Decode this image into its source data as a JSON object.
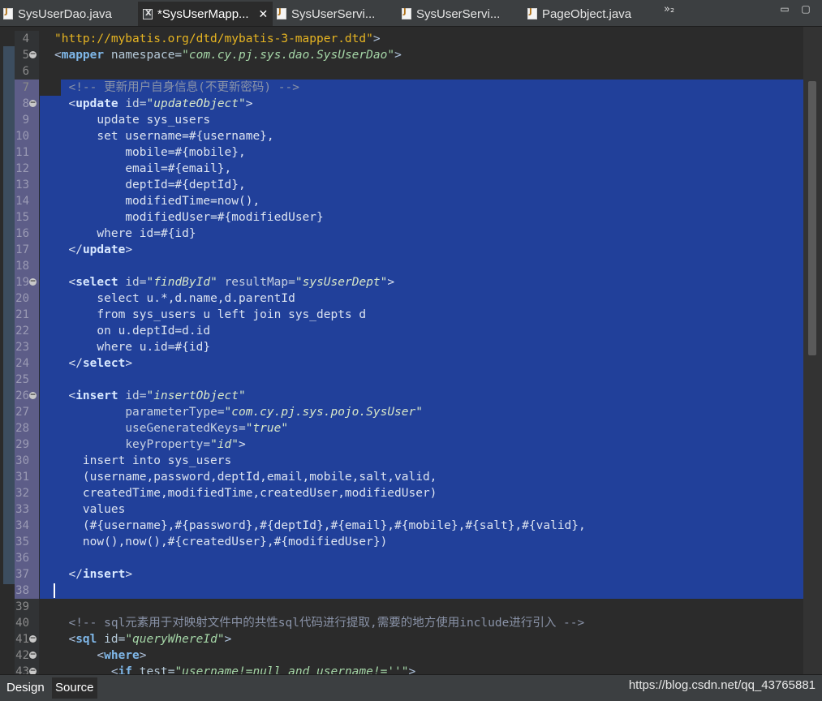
{
  "tabs": [
    {
      "label": "SysUserDao.java",
      "icon": "java-file-icon",
      "active": false
    },
    {
      "label": "*SysUserMapp...",
      "icon": "xml-file-icon",
      "active": true,
      "close": "✕"
    },
    {
      "label": "SysUserServi...",
      "icon": "java-file-icon",
      "active": false
    },
    {
      "label": "SysUserServi...",
      "icon": "java-file-icon",
      "active": false
    },
    {
      "label": "PageObject.java",
      "icon": "java-file-icon",
      "active": false
    }
  ],
  "tab_overflow": "»₂",
  "window_buttons": {
    "minimize": "▭",
    "maximize": "▢"
  },
  "editor": {
    "lines": [
      {
        "num": "4",
        "html": "<span class=\"dtd\">\"http://mybatis.org/dtd/mybatis-3-mapper.dtd\"</span><span class=\"punct\">&gt;</span>"
      },
      {
        "num": "5",
        "fold": "−",
        "html": "<span class=\"punct\">&lt;</span><span class=\"tag\">mapper</span> <span class=\"attr\">namespace=</span><span class=\"str\">\"com.cy.pj.sys.dao.SysUserDao\"</span><span class=\"punct\">&gt;</span>"
      },
      {
        "num": "6",
        "html": ""
      },
      {
        "num": "7",
        "partial": true,
        "html": "  <span class=\"cmt\">&lt;!-- 更新用户自身信息(不更新密码) --&gt;</span>"
      },
      {
        "num": "8",
        "sel": true,
        "fold": "−",
        "html": "  <span class=\"punct\">&lt;</span><span class=\"tag\">update</span> <span class=\"attr\">id=</span><span class=\"str\">\"updateObject\"</span><span class=\"punct\">&gt;</span>"
      },
      {
        "num": "9",
        "sel": true,
        "html": "      <span class=\"txtc\">update sys_users</span>"
      },
      {
        "num": "10",
        "sel": true,
        "html": "      <span class=\"txtc\">set username=#{username},</span>"
      },
      {
        "num": "11",
        "sel": true,
        "html": "          <span class=\"txtc\">mobile=#{mobile},</span>"
      },
      {
        "num": "12",
        "sel": true,
        "html": "          <span class=\"txtc\">email=#{email},</span>"
      },
      {
        "num": "13",
        "sel": true,
        "html": "          <span class=\"txtc\">deptId=#{deptId},</span>"
      },
      {
        "num": "14",
        "sel": true,
        "html": "          <span class=\"txtc\">modifiedTime=now(),</span>"
      },
      {
        "num": "15",
        "sel": true,
        "html": "          <span class=\"txtc\">modifiedUser=#{modifiedUser}</span>"
      },
      {
        "num": "16",
        "sel": true,
        "html": "      <span class=\"txtc\">where id=#{id}</span>"
      },
      {
        "num": "17",
        "sel": true,
        "html": "  <span class=\"punct\">&lt;/</span><span class=\"tag\">update</span><span class=\"punct\">&gt;</span>"
      },
      {
        "num": "18",
        "sel": true,
        "html": ""
      },
      {
        "num": "19",
        "sel": true,
        "fold": "−",
        "html": "  <span class=\"punct\">&lt;</span><span class=\"tag\">select</span> <span class=\"attr\">id=</span><span class=\"str\">\"findById\"</span> <span class=\"attr\">resultMap=</span><span class=\"str\">\"sysUserDept\"</span><span class=\"punct\">&gt;</span>"
      },
      {
        "num": "20",
        "sel": true,
        "html": "      <span class=\"txtc\">select u.*,d.name,d.parentId</span>"
      },
      {
        "num": "21",
        "sel": true,
        "html": "      <span class=\"txtc\">from sys_users u left join sys_depts d</span>"
      },
      {
        "num": "22",
        "sel": true,
        "html": "      <span class=\"txtc\">on u.deptId=d.id</span>"
      },
      {
        "num": "23",
        "sel": true,
        "html": "      <span class=\"txtc\">where u.id=#{id}</span>"
      },
      {
        "num": "24",
        "sel": true,
        "html": "  <span class=\"punct\">&lt;/</span><span class=\"tag\">select</span><span class=\"punct\">&gt;</span>"
      },
      {
        "num": "25",
        "sel": true,
        "html": ""
      },
      {
        "num": "26",
        "sel": true,
        "fold": "−",
        "html": "  <span class=\"punct\">&lt;</span><span class=\"tag\">insert</span> <span class=\"attr\">id=</span><span class=\"str\">\"insertObject\"</span>"
      },
      {
        "num": "27",
        "sel": true,
        "html": "          <span class=\"attr\">parameterType=</span><span class=\"str\">\"com.cy.pj.sys.pojo.SysUser\"</span>"
      },
      {
        "num": "28",
        "sel": true,
        "html": "          <span class=\"attr\">useGeneratedKeys=</span><span class=\"str\">\"true\"</span>"
      },
      {
        "num": "29",
        "sel": true,
        "html": "          <span class=\"attr\">keyProperty=</span><span class=\"str\">\"id\"</span><span class=\"punct\">&gt;</span>"
      },
      {
        "num": "30",
        "sel": true,
        "html": "    <span class=\"txtc\">insert into sys_users</span>"
      },
      {
        "num": "31",
        "sel": true,
        "html": "    <span class=\"txtc\">(username,password,deptId,email,mobile,salt,valid,</span>"
      },
      {
        "num": "32",
        "sel": true,
        "html": "    <span class=\"txtc\">createdTime,modifiedTime,createdUser,modifiedUser)</span>"
      },
      {
        "num": "33",
        "sel": true,
        "html": "    <span class=\"txtc\">values</span>"
      },
      {
        "num": "34",
        "sel": true,
        "html": "    <span class=\"txtc\">(#{username},#{password},#{deptId},#{email},#{mobile},#{salt},#{valid},</span>"
      },
      {
        "num": "35",
        "sel": true,
        "html": "    <span class=\"txtc\">now(),now(),#{createdUser},#{modifiedUser})</span>"
      },
      {
        "num": "36",
        "sel": true,
        "html": ""
      },
      {
        "num": "37",
        "sel": true,
        "html": "  <span class=\"punct\">&lt;/</span><span class=\"tag\">insert</span><span class=\"punct\">&gt;</span>"
      },
      {
        "num": "38",
        "sel": true,
        "caret": true,
        "html": ""
      },
      {
        "num": "39",
        "html": ""
      },
      {
        "num": "40",
        "html": "  <span class=\"cmt\">&lt;!-- sql元素用于对映射文件中的共性sql代码进行提取,需要的地方使用include进行引入 --&gt;</span>"
      },
      {
        "num": "41",
        "fold": "−",
        "html": "  <span class=\"punct\">&lt;</span><span class=\"tag\">sql</span> <span class=\"attr\">id=</span><span class=\"str\">\"queryWhereId\"</span><span class=\"punct\">&gt;</span>"
      },
      {
        "num": "42",
        "fold": "−",
        "html": "      <span class=\"punct\">&lt;</span><span class=\"tag\">where</span><span class=\"punct\">&gt;</span>"
      },
      {
        "num": "43",
        "fold": "−",
        "html": "        <span class=\"punct\">&lt;</span><span class=\"tag\">if</span> <span class=\"attr\">test=</span><span class=\"str\">\"username!=null and username!=''\"</span><span class=\"punct\">&gt;</span>"
      }
    ]
  },
  "bottom_tabs": [
    {
      "label": "Design",
      "active": false
    },
    {
      "label": "Source",
      "active": true
    }
  ],
  "watermark": "https://blog.csdn.net/qq_43765881"
}
